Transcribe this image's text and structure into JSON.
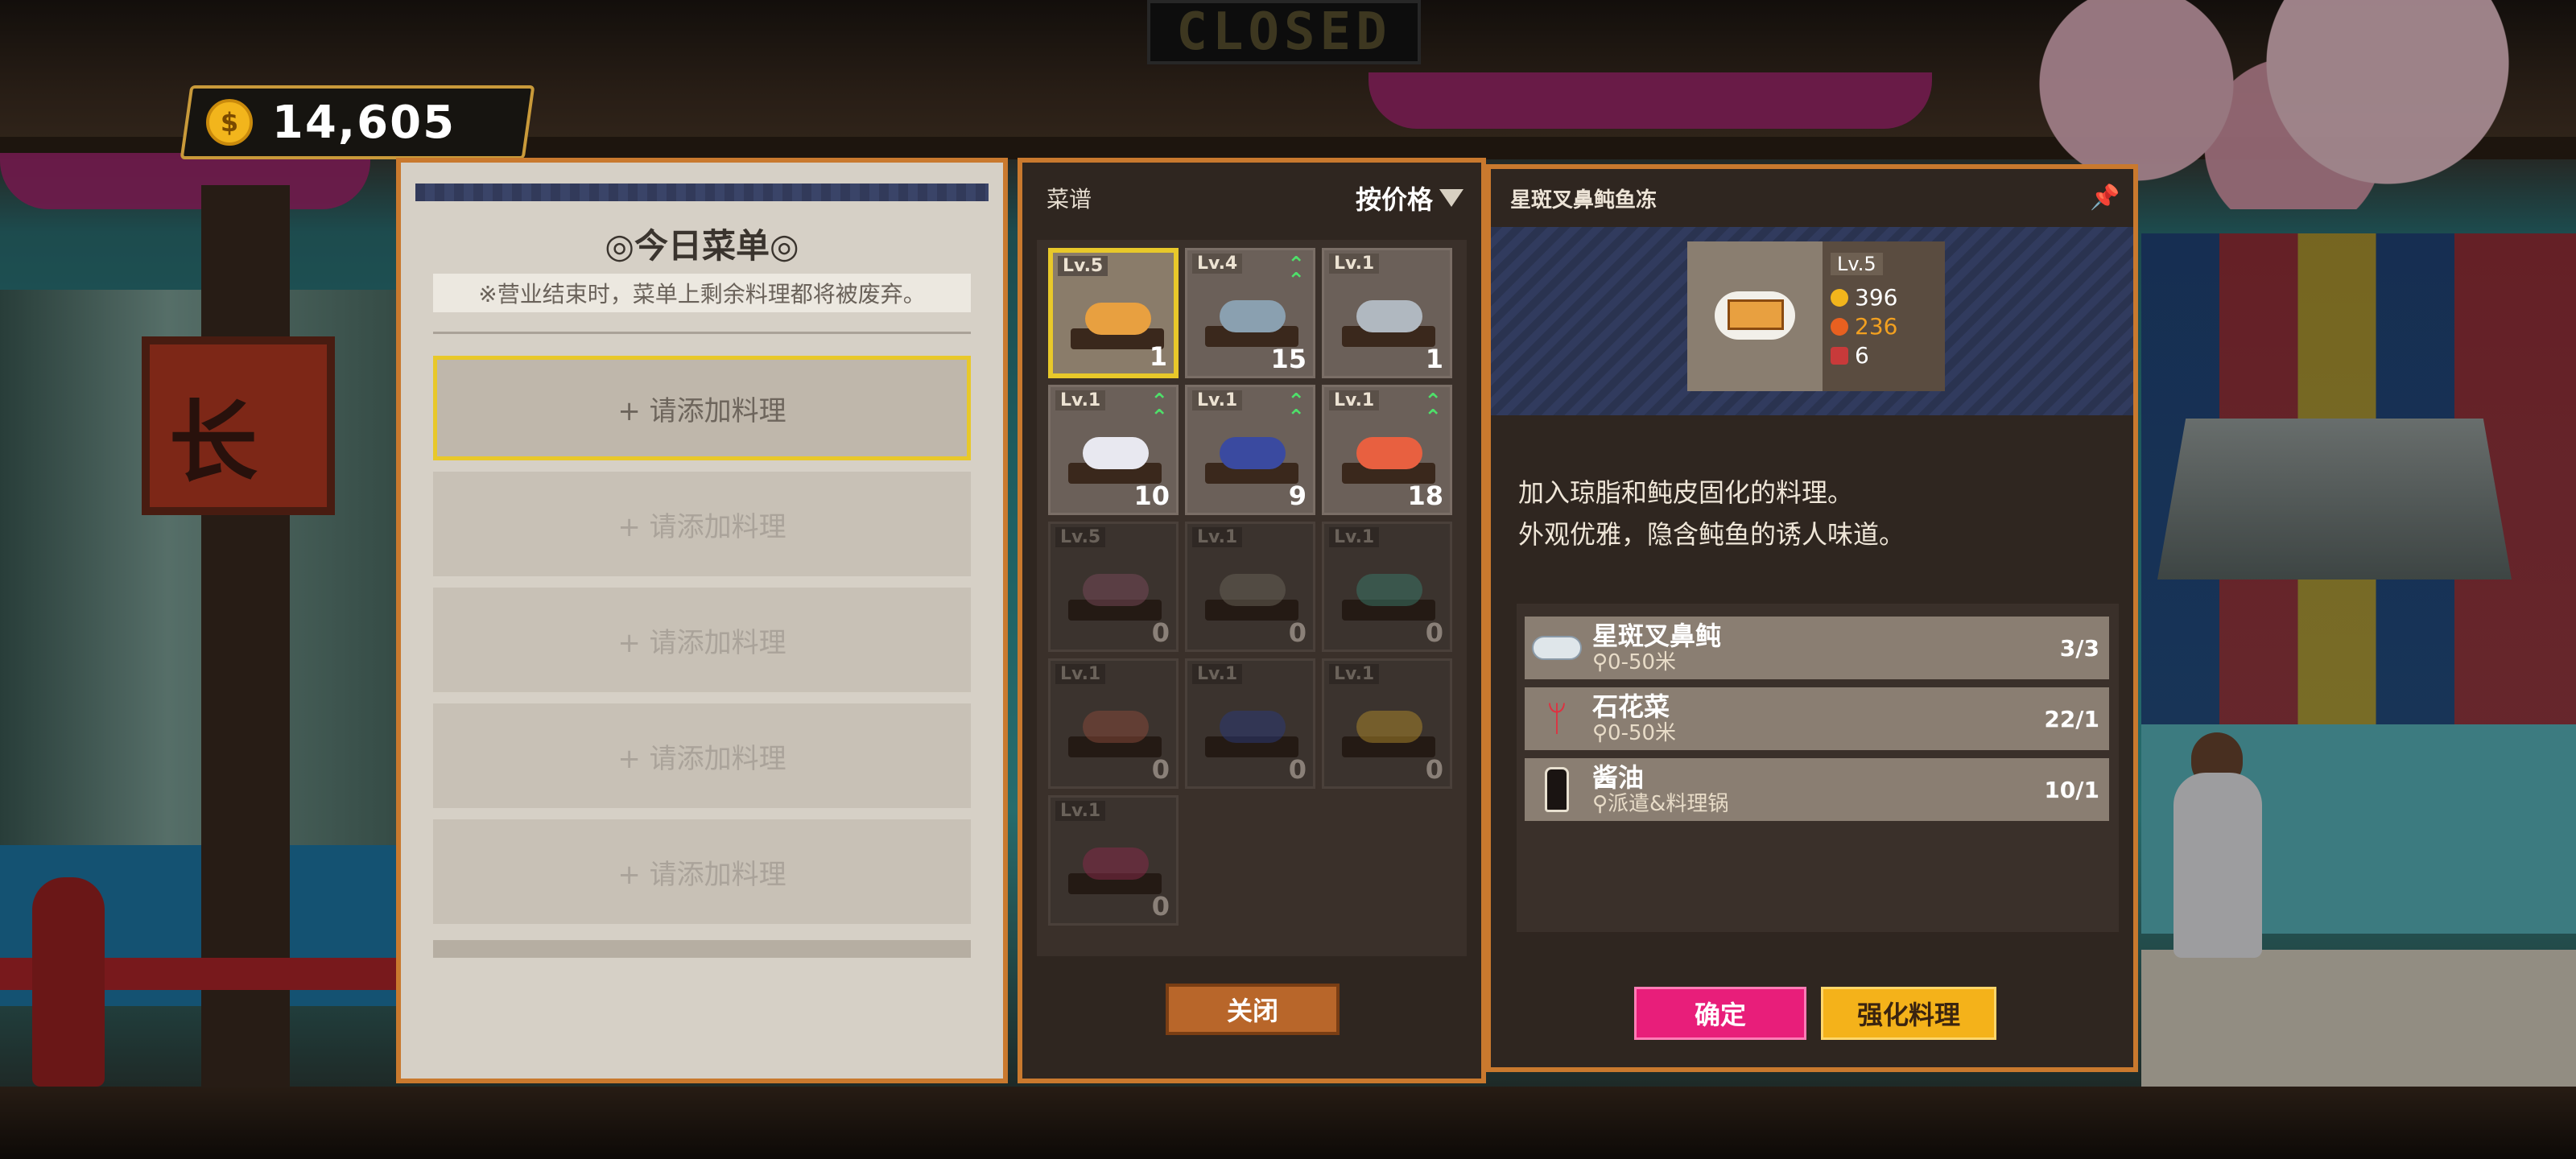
{
  "scene": {
    "closed_sign": "CLOSED"
  },
  "hud": {
    "coin_icon": "coin-icon",
    "coins": "14,605"
  },
  "menu": {
    "title": "◎今日菜单◎",
    "note": "※营业结束时，菜单上剩余料理都将被废弃。",
    "slots": [
      "+ 请添加料理",
      "+ 请添加料理",
      "+ 请添加料理",
      "+ 请添加料理",
      "+ 请添加料理"
    ]
  },
  "recipes": {
    "header_label": "菜谱",
    "sort_label": "按价格",
    "close_button": "关闭",
    "items": [
      {
        "level": "Lv.5",
        "count": "1",
        "upgrade": false,
        "unlocked": true,
        "selected": true,
        "color": "#e8a040"
      },
      {
        "level": "Lv.4",
        "count": "15",
        "upgrade": true,
        "unlocked": true,
        "selected": false,
        "color": "#8aa0b0"
      },
      {
        "level": "Lv.1",
        "count": "1",
        "upgrade": false,
        "unlocked": true,
        "selected": false,
        "color": "#b0b8c0"
      },
      {
        "level": "Lv.1",
        "count": "10",
        "upgrade": true,
        "unlocked": true,
        "selected": false,
        "color": "#e8e8f0"
      },
      {
        "level": "Lv.1",
        "count": "9",
        "upgrade": true,
        "unlocked": true,
        "selected": false,
        "color": "#3a4aa0"
      },
      {
        "level": "Lv.1",
        "count": "18",
        "upgrade": true,
        "unlocked": true,
        "selected": false,
        "color": "#e86040"
      },
      {
        "level": "Lv.5",
        "count": "0",
        "upgrade": false,
        "unlocked": false,
        "selected": false,
        "color": "#7a4a5a"
      },
      {
        "level": "Lv.1",
        "count": "0",
        "upgrade": false,
        "unlocked": false,
        "selected": false,
        "color": "#6a6458"
      },
      {
        "level": "Lv.1",
        "count": "0",
        "upgrade": false,
        "unlocked": false,
        "selected": false,
        "color": "#3a7a6a"
      },
      {
        "level": "Lv.1",
        "count": "0",
        "upgrade": false,
        "unlocked": false,
        "selected": false,
        "color": "#8a4a3a"
      },
      {
        "level": "Lv.1",
        "count": "0",
        "upgrade": false,
        "unlocked": false,
        "selected": false,
        "color": "#2a3a7a"
      },
      {
        "level": "Lv.1",
        "count": "0",
        "upgrade": false,
        "unlocked": false,
        "selected": false,
        "color": "#b08a2a"
      },
      {
        "level": "Lv.1",
        "count": "0",
        "upgrade": false,
        "unlocked": false,
        "selected": false,
        "color": "#8a2a4a"
      }
    ]
  },
  "detail": {
    "name": "星斑叉鼻鲀鱼冻",
    "level": "Lv.5",
    "price": "396",
    "taste": "236",
    "servings": "6",
    "description_1": "加入琼脂和鲀皮固化的料理。",
    "description_2": "外观优雅，隐含鲀鱼的诱人味道。",
    "ingredients": [
      {
        "name": "星斑叉鼻鲀",
        "location": "0-50米",
        "qty": "3/3",
        "icon": "pufferfish-icon"
      },
      {
        "name": "石花菜",
        "location": "0-50米",
        "qty": "22/1",
        "icon": "seaweed-icon"
      },
      {
        "name": "酱油",
        "location": "派遣&料理锅",
        "qty": "10/1",
        "icon": "soy-sauce-icon"
      }
    ],
    "confirm_button": "确定",
    "enhance_button": "强化料理",
    "colors": {
      "confirm": "#e81e7a",
      "enhance": "#f4b21a",
      "frame": "#c9792e"
    }
  }
}
